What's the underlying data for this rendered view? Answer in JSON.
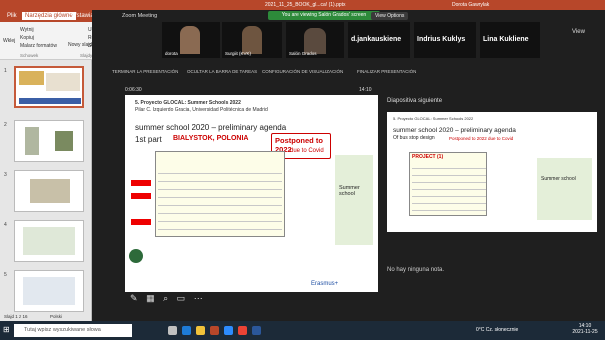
{
  "ppt": {
    "title": "2021_11_25_BOOK_gl...ca! (1).pptx",
    "user": "Dorota Gawrylak"
  },
  "ribbon_tabs": [
    "Plik",
    "Narzędzia główne",
    "Wstawianie"
  ],
  "ribbon_buttons": {
    "paste": "Wklej",
    "cut": "Wytnij",
    "copy": "Kopiuj",
    "painter": "Malarz formatów",
    "new": "Nowy slajd",
    "layout": "Układ",
    "reset": "Resetuj",
    "section": "Sekcja"
  },
  "ribbon_groups": {
    "clipboard": "Schowek",
    "slides": "Slajdy"
  },
  "thumb_numbers": [
    "1",
    "2",
    "3",
    "4",
    "5"
  ],
  "zoom": {
    "title": "Zoom Meeting",
    "banner": "You are viewing Salón Grados' screen",
    "view_options": "View Options"
  },
  "participants": [
    "dorota",
    "Surgiit (KVK)",
    "Salón Grados",
    "d.jankauskiene",
    "Indrius Kuklys",
    "Lina Kukliene"
  ],
  "view_btn": "View",
  "presenter_bar": [
    "TERMINAR LA PRESENTACIÓN",
    "OCULTAR LA BARRA DE TAREAS",
    "CONFIGURACIÓN DE VISUALIZACIÓN",
    "FINALIZAR PRESENTACIÓN"
  ],
  "timer": "0:06:30",
  "clock": "14:10",
  "slide": {
    "header": "5. Proyecto GLOCAL: Summer Schools 2022",
    "author": "Pilar C. Izquierdo Gracia, Universidad Politécnica de Madrid",
    "title1": "summer school 2020 – preliminary agenda",
    "part": "1st part",
    "city": "BIALYSTOK, POLONIA",
    "postponed": "Postponed to 2022",
    "reason": "due to Covid",
    "side": "Summer school",
    "footer": "Erasmus+"
  },
  "next": {
    "label": "Diapositiva siguiente",
    "header": "5. Proyecto GLOCAL: Summer Schools 2022",
    "title1": "summer school 2020 – preliminary agenda",
    "part": "Of bus stop design",
    "postponed": "Postponed to 2022 due to Covid",
    "project": "PROJECT (1)",
    "side": "Summer school"
  },
  "notes": "No hay ninguna nota.",
  "status": {
    "slide": "Slajd 1 z 16",
    "lang": "Polski"
  },
  "taskbar": {
    "search": "Tutaj wpisz wyszukiwane słowa",
    "weather": "0°C  Cz. słonecznie",
    "time": "14:10",
    "date": "2021-11-25"
  }
}
